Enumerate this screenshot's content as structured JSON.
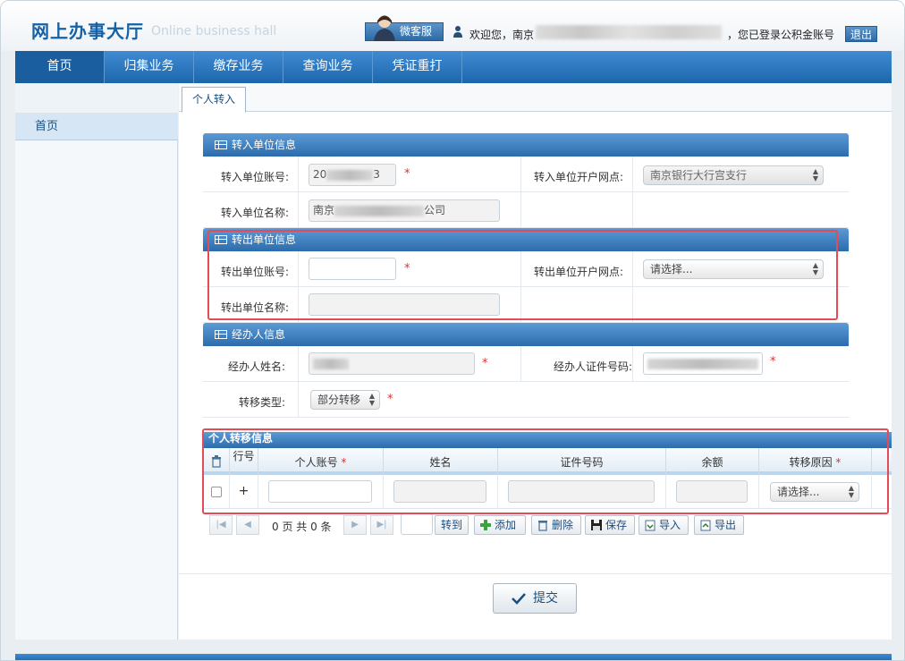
{
  "header": {
    "logo": "网上办事大厅",
    "logo_en": "Online business hall",
    "cs_label": "微客服",
    "welcome_prefix": "欢迎您，南京",
    "welcome_suffix": "，您已登录公积金账号",
    "logout": "退出"
  },
  "nav": {
    "items": [
      "首页",
      "归集业务",
      "缴存业务",
      "查询业务",
      "凭证重打"
    ],
    "active_index": 0
  },
  "sidebar": {
    "items": [
      "首页"
    ]
  },
  "tabs": [
    {
      "label": "个人转入"
    }
  ],
  "sections": {
    "in_unit": {
      "title": "转入单位信息",
      "account_label": "转入单位账号:",
      "account_prefix": "20",
      "account_suffix": "3",
      "branch_label": "转入单位开户网点:",
      "branch_value": "南京银行大行宫支行",
      "name_label": "转入单位名称:",
      "name_prefix": "南京",
      "name_suffix": "公司"
    },
    "out_unit": {
      "title": "转出单位信息",
      "account_label": "转出单位账号:",
      "branch_label": "转出单位开户网点:",
      "branch_placeholder": "请选择...",
      "name_label": "转出单位名称:"
    },
    "agent": {
      "title": "经办人信息",
      "name_label": "经办人姓名:",
      "id_label": "经办人证件号码:",
      "type_label": "转移类型:",
      "type_value": "部分转移"
    }
  },
  "grid": {
    "title": "个人转移信息",
    "columns": [
      "行号",
      "个人账号",
      "姓名",
      "证件号码",
      "余额",
      "转移原因"
    ],
    "row_add": "+",
    "reason_placeholder": "请选择..."
  },
  "pager": {
    "info": "0 页 共 0 条",
    "goto": "转到",
    "add": "添加",
    "delete": "删除",
    "save": "保存",
    "import": "导入",
    "export": "导出"
  },
  "submit": "提交",
  "colors": {
    "nav": "#1d66ad",
    "section": "#2d6cac",
    "highlight": "#e54b57",
    "required": "#e03030"
  }
}
